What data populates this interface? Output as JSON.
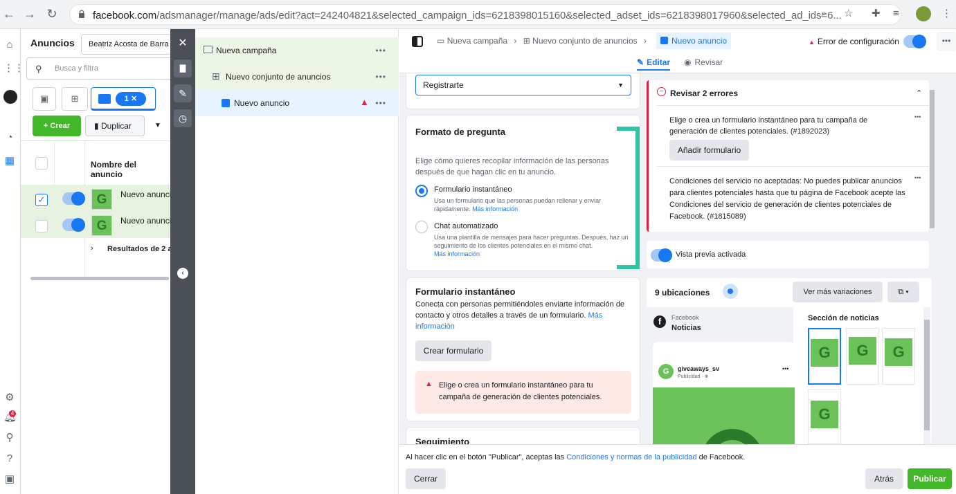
{
  "browser": {
    "url_host": "facebook.com",
    "url_path": "/adsmanager/manage/ads/edit?act=242404821&selected_campaign_ids=6218398015160&selected_adset_ids=6218398017960&selected_ad_ids=6...",
    "icons": [
      "back-icon",
      "forward-icon",
      "reload-icon",
      "lock-icon",
      "zoom-icon",
      "star-icon",
      "extensions-icon",
      "media-icon",
      "profile-icon",
      "menu-icon"
    ]
  },
  "ads_panel": {
    "title": "Anuncios",
    "account": "Beatriz Acosta de Barra",
    "search_placeholder": "Busca y filtra",
    "selected_chip": "1 ✕",
    "create_label": "+ Crear",
    "duplicate_label": "Duplicar",
    "column_header": "Nombre del anuncio",
    "rows": [
      {
        "name": "Nuevo anuncio",
        "checked": true,
        "thumb": "G"
      },
      {
        "name": "Nuevo anuncio",
        "checked": false,
        "thumb": "G"
      }
    ],
    "results_label": "Resultados de 2 a"
  },
  "tree": {
    "campaign": "Nueva campaña",
    "adset": "Nuevo conjunto de anuncios",
    "ad": "Nuevo anuncio"
  },
  "breadcrumb": {
    "campaign": "Nueva campaña",
    "adset": "Nuevo conjunto de anuncios",
    "ad": "Nuevo anuncio",
    "error": "Error de configuración"
  },
  "mode_tabs": {
    "edit": "Editar",
    "review": "Revisar"
  },
  "form": {
    "cta_select": "Registrarte",
    "question_format_title": "Formato de pregunta",
    "question_format_desc": "Elige cómo quieres recopilar información de las personas después de que hagan clic en tu anuncio.",
    "option1_title": "Formulario instantáneo",
    "option1_desc": "Usa un formulario que las personas puedan rellenar y enviar rápidamente.",
    "option1_link": "Más información",
    "option2_title": "Chat automatizado",
    "option2_desc": "Usa una plantilla de mensajes para hacer preguntas. Después, haz un seguimiento de los clientes potenciales en el mismo chat.",
    "option2_link": "Más información",
    "instant_form_title": "Formulario instantáneo",
    "instant_form_desc": "Conecta con personas permitiéndoles enviarte información de contacto y otros detalles a través de un formulario.",
    "instant_form_link": "Más información",
    "create_form_label": "Crear formulario",
    "error_text": "Elige o crea un formulario instantáneo para tu campaña de generación de clientes potenciales.",
    "tracking_title": "Seguimiento"
  },
  "errors": {
    "title": "Revisar 2 errores",
    "error1": "Elige o crea un formulario instantáneo para tu campaña de generación de clientes potenciales. (#1892023)",
    "add_form_label": "Añadir formulario",
    "error2": "Condiciones del servicio no aceptadas: No puedes publicar anuncios para clientes potenciales hasta que tu página de Facebook acepte las Condiciones del servicio de generación de clientes potenciales de Facebook. (#1815089)"
  },
  "preview": {
    "toggle_label": "Vista previa activada",
    "placements_label": "9 ubicaciones",
    "more_variations_label": "Ver más variaciones",
    "platform": "Facebook",
    "placement": "Noticias",
    "feed_section": "Sección de noticias",
    "page_name": "giveaways_sv",
    "sponsored": "Publicidad · ⊕",
    "thumb_letter": "G"
  },
  "footer": {
    "notice_prefix": "Al hacer clic en el botón \"Publicar\", aceptas las ",
    "notice_link": "Condiciones y normas de la publicidad",
    "notice_suffix": " de Facebook.",
    "close_label": "Cerrar",
    "back_label": "Atrás",
    "publish_label": "Publicar"
  },
  "colors": {
    "accent": "#1877f2",
    "green": "#42b72a",
    "error": "#e0245e",
    "annotation": "#2ec4a6"
  }
}
